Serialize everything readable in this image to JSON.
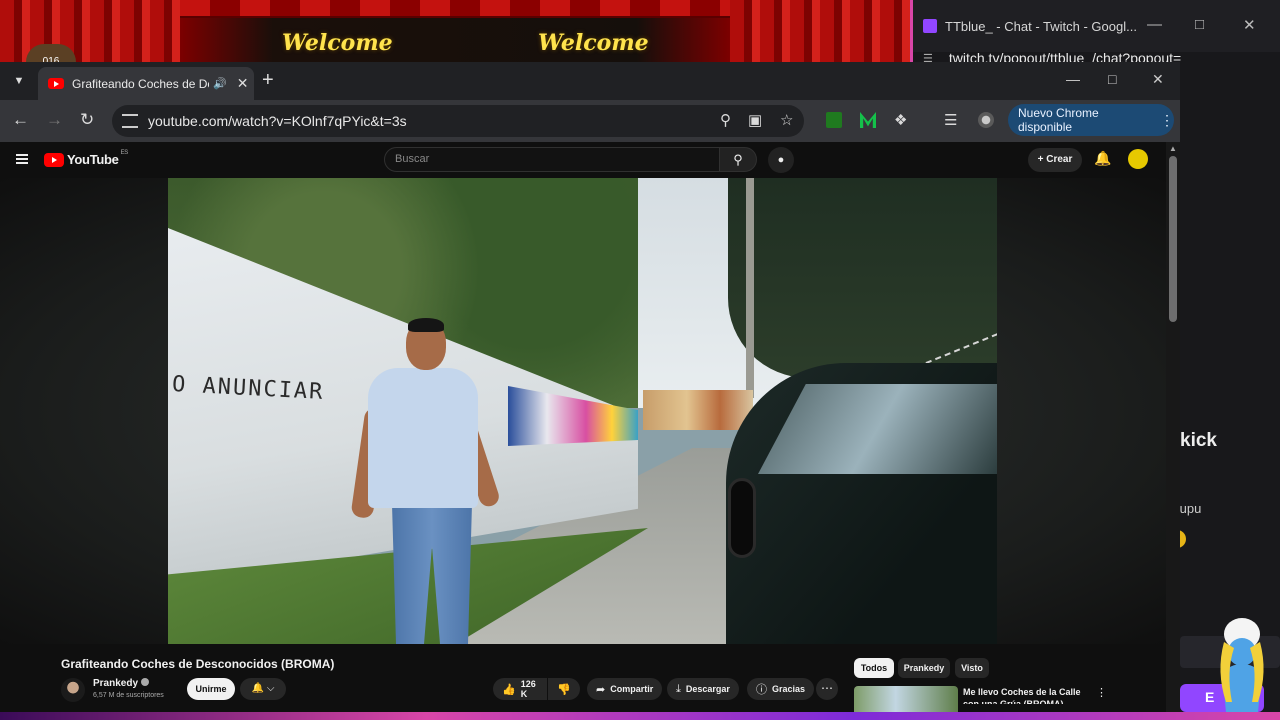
{
  "overlay": {
    "welcome_1": "Welcome",
    "welcome_2": "Welcome",
    "badge": "016"
  },
  "twitch_window": {
    "title": "TTblue_ - Chat - Twitch - Googl...",
    "url": "twitch.tv/popout/ttblue_/chat?popout=",
    "chat_text_1": "kick",
    "chat_text_2": "tupu",
    "chat_button": "E"
  },
  "browser": {
    "tab_title": "Grafiteando Coches de Desconocidos (BROMA)",
    "url": "youtube.com/watch?v=KOlnf7qPYic&t=3s",
    "update_button": "Nuevo Chrome disponible",
    "accent": "#1c4a74"
  },
  "youtube": {
    "logo_text": "YouTube",
    "region": "ES",
    "search_placeholder": "Buscar",
    "create_label": "Crear",
    "video_title": "Grafiteando Coches de Desconocidos (BROMA)",
    "channel_name": "Prankedy",
    "subscribers": "6,57 M de suscriptores",
    "join_label": "Unirme",
    "likes": "126 K",
    "share_label": "Compartir",
    "download_label": "Descargar",
    "thanks_label": "Gracias",
    "in_video_text": "O ANUNCIAR",
    "chips": [
      "Todos",
      "Prankedy",
      "Visto"
    ],
    "recommended_title": "Me llevo Coches de la Calle con una Grúa (BROMA)"
  }
}
